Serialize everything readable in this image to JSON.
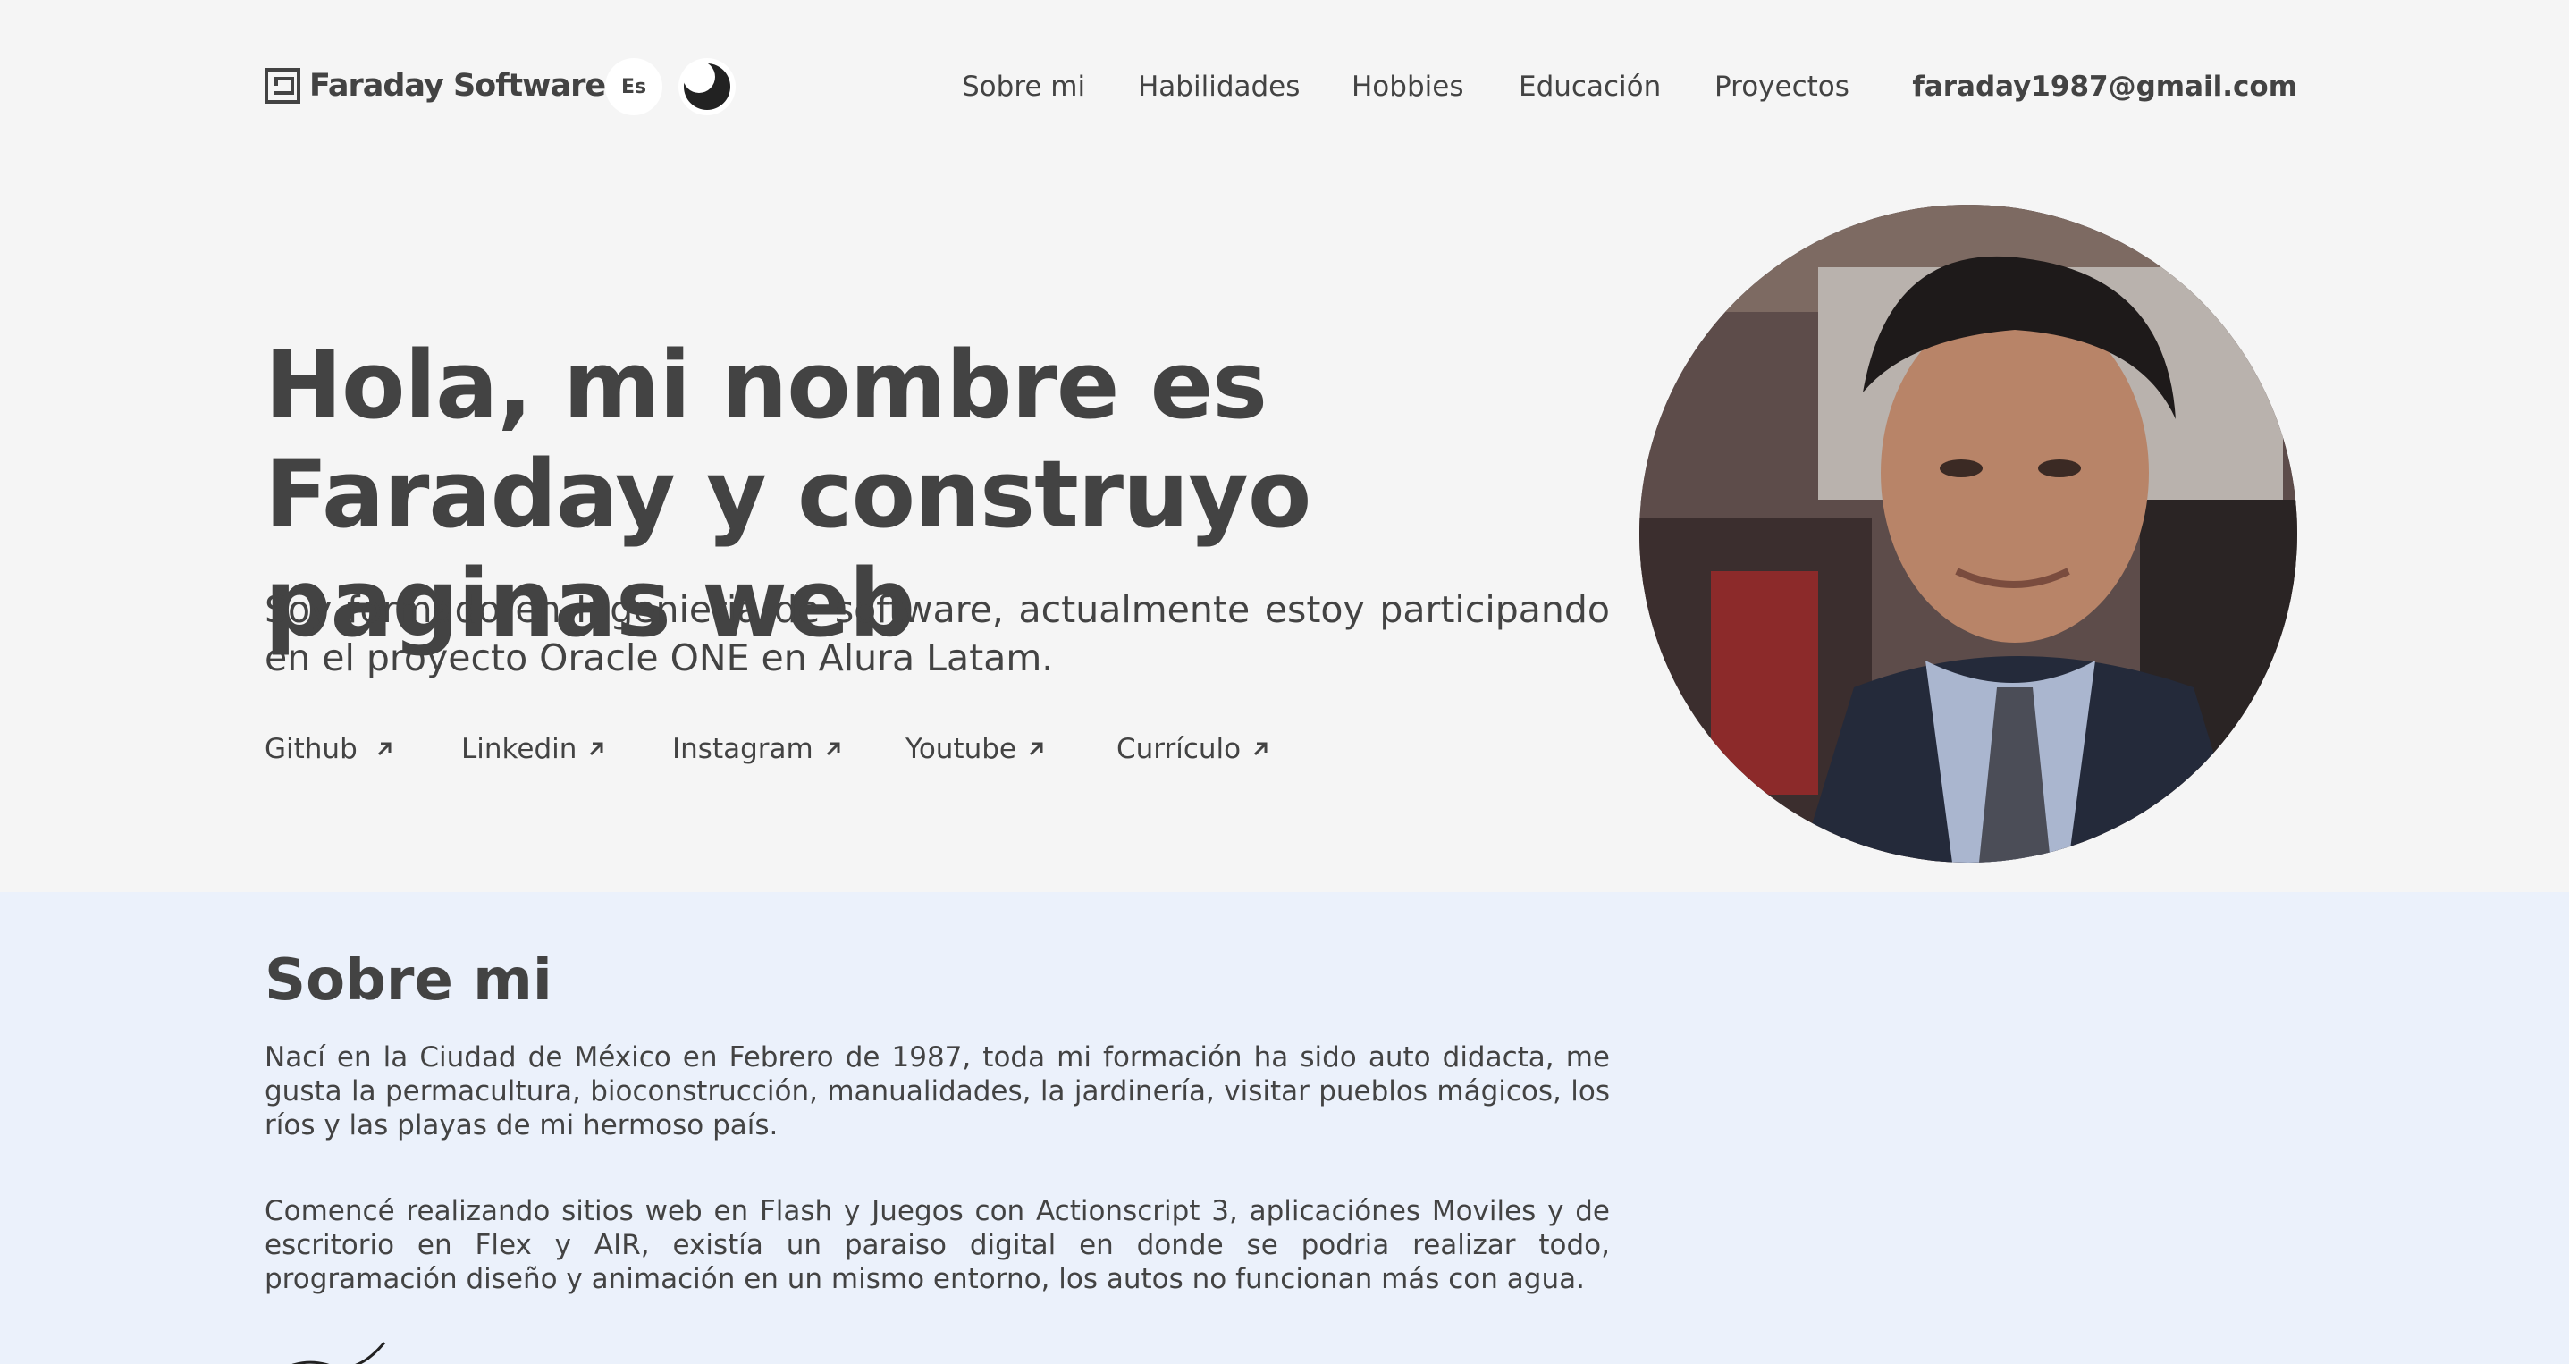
{
  "header": {
    "brand": "Faraday Software",
    "language": "Es",
    "nav": [
      "Sobre mi",
      "Habilidades",
      "Hobbies",
      "Educación",
      "Proyectos"
    ],
    "email": "faraday1987@gmail.com"
  },
  "hero": {
    "title": "Hola, mi nombre es Faraday y construyo paginas web",
    "subtitle": "Soy formado en Ingenieria de software, actualmente estoy participando en el proyecto Oracle ONE en Alura Latam.",
    "links": [
      "Github",
      "Linkedin",
      "Instagram",
      "Youtube",
      "Currículo"
    ]
  },
  "about": {
    "title": "Sobre mi",
    "paragraphs": [
      "Nací en la Ciudad de México en Febrero de 1987, toda mi formación ha sido auto didacta, me gusta la permacultura, bioconstrucción, manualidades, la jardinería, visitar pueblos mágicos, los ríos y las playas de mi hermoso país.",
      "Comencé realizando sitios web en Flash y Juegos con Actionscript 3, aplicaciónes Moviles y de escritorio en Flex y AIR, existía un paraiso digital en donde se podria realizar todo, programación diseño y animación en un mismo entorno, los autos no funcionan más con agua."
    ]
  },
  "icons": {
    "logo": "logo-icon",
    "theme": "moon-icon",
    "external": "arrow-up-right-icon"
  },
  "colors": {
    "text": "#434343",
    "background": "#f5f5f5",
    "about_background": "#ebf1fb"
  }
}
